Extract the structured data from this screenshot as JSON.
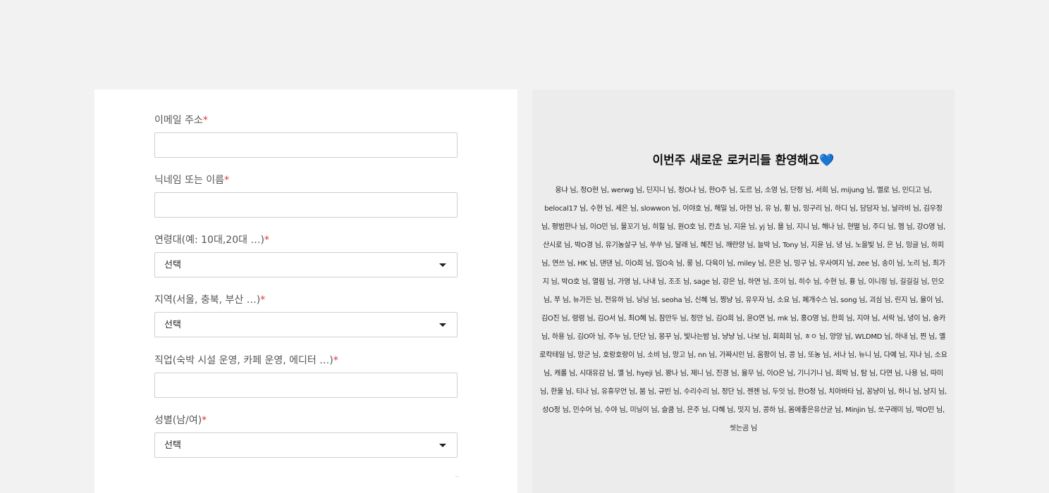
{
  "form": {
    "fields": [
      {
        "label": "이메일 주소",
        "required_mark": "*",
        "type": "text",
        "value": ""
      },
      {
        "label": "닉네임 또는 이름",
        "required_mark": "*",
        "type": "text",
        "value": ""
      },
      {
        "label": "연령대(예: 10대,20대 …)",
        "required_mark": "*",
        "type": "select",
        "value": "선택"
      },
      {
        "label": "지역(서울, 충북, 부산 …)",
        "required_mark": "*",
        "type": "select",
        "value": "선택"
      },
      {
        "label": "직업(숙박 시설 운영, 카페 운영, 에디터 …)",
        "required_mark": "*",
        "type": "text",
        "value": ""
      },
      {
        "label": "성별(남/여)",
        "required_mark": "*",
        "type": "select",
        "value": "선택"
      }
    ]
  },
  "welcome": {
    "title": "이번주 새로운 로커리들 환영해요",
    "title_emoji": "💙",
    "names": "웅냐 님, 정O현 님, werwg 님, 딘지니 님, 정O나 님, 한O주 님, 도르 님, 소영 님, 단정 님, 서희 님, mijung 님, 멜로 님, 인디고 님, belocal17 님, 수현 님, 세은 님, slowwon 님, 이야호 님, 해밀 님, 아현 님, 유 님, 휭 님, 밍구리 님, 하디 님, 담담자 님, 날라비 님, 김우정 님, 평범한나 님, 이O민 님, 물꼬기 님, 히힐 님, 원O호 님, 칸쵸 님, 지윤 님, yj 님, 욜 님, 지니 님, 해나 님, 현뗠 님, 주디 님, 헴 님, 강O영 님, 산시로 님, 박O경 님, 유기농살구 님, 쑤쑤 님, 달래 님, 혜진 님, 깨란양 님, 늘박 님, Tony 님, 지윤 님, 녕 님, 노을빛 님, 은 님, 밍글 님, 하피 님, 연쓰 님, HK 님, 댄댄 님, 이O희 님, 임O숙 님, 룽 님, 다육이 님, miley 님, 은은 님, 밍구 님, 우사여지 님, zee 님, 송이 님, 노리 님, 최가지 님, 박O호 님, 열림 님, 가영 님, 나내 님, 조조 님, sage 님, 강은 님, 하연 님, 조이 님, 히수 님, 수현 님, 흉 님, 이니링 님, 길길길 님, 민오 님, 쭈 님, 뉴가든 님, 전유하 님, 닝닝 님, seoha 님, 신혜 님, 찡냥 님, 유우자 님, 소요 님, 폐개수스 님, song 님, 괴심 님, 린지 님, 율이 님, 김O진 님, 령령 님, 김O서 님, 최O혜 님, 참만두 님, 정만 님, 김O희 님, 윤O연 님, mk 님, 홍O영 님, 한희 님, 지야 님, 서락 님, 녕이 님, 숑카 님, 하용 님, 김O아 님, 주누 님, 단단 님, 몽꾸 님, 빛나는밤 님, 냥냥 님, 나보 님, 회희희 님, ㅎㅇ 님, 양양 님, WLDMD 님, 하내 님, 찐 님, 옐로칵테일 님, 망군 님, 호랑호랑이 님, 소비 님, 망고 님, nn 님, 가짜시인 님, 움팡이 님, 콩 님, 또농 님, 서나 님, 뉴니 님, 다예 님, 지나 님, 소요 님, 캐롤 님, 시대유감 님, 옐 님, hyeji 님, 꽝나 님, 제니 님, 진경 님, 율무 님, 이O은 님, 기니기니 님, 희박 님, 탐 님, 다연 님, 나용 님, 따미 님, 한울 님, 티나 님, 유휴무언 님, 붐 님, 규빈 님, 수리수리 님, 정단 님, 젠젠 님, 두잇 님, 한O정 님, 치아바타 님, 꽁냥이 님, 허니 님, 냠지 님, 성O정 님, 민수어 님, 수야 님, 미닝이 님, 슬쿰 님, 은주 님, 다혜 님, 밋지 님, 콩하 님, 몸에좋은유산균 님, Minjin 님, 쏘구래미 님, 박O민 님, 씻는곰 님"
  }
}
